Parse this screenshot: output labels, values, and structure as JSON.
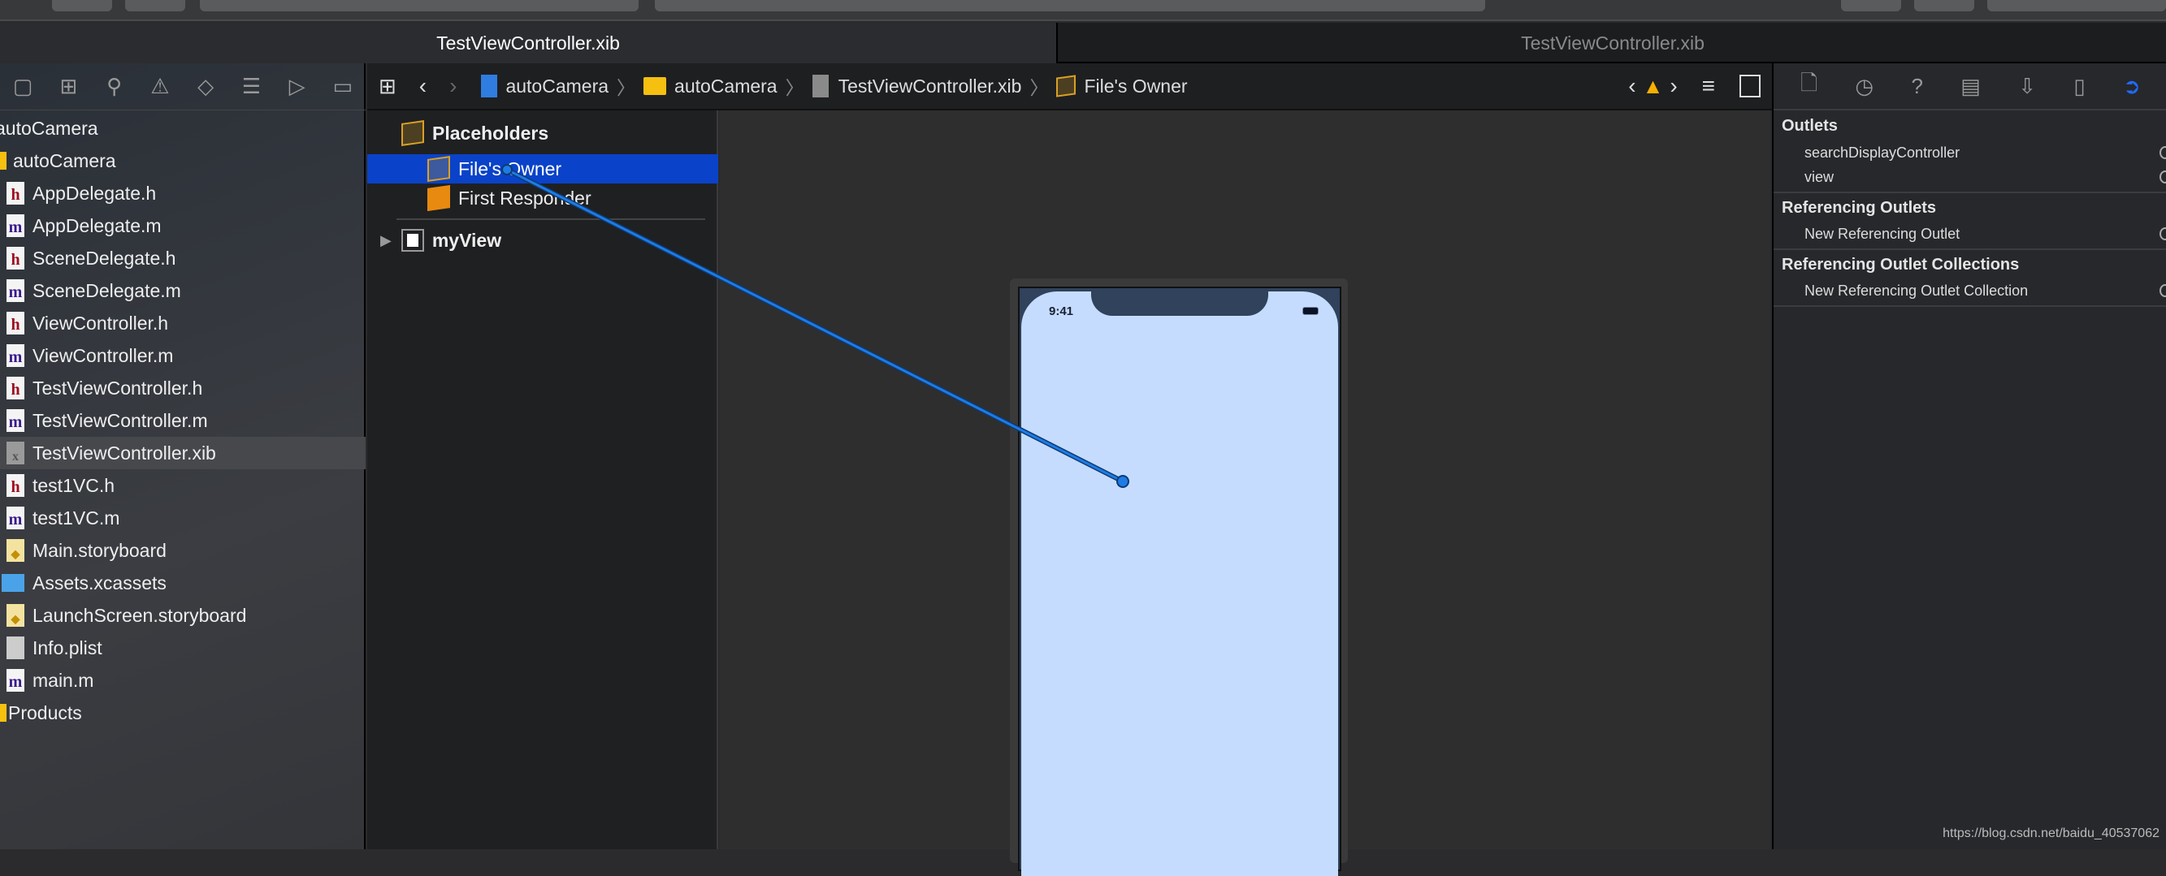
{
  "tabs": [
    {
      "label": "TestViewController.xib",
      "active": true
    },
    {
      "label": "TestViewController.xib",
      "active": false
    }
  ],
  "navigator": {
    "project": "autoCamera",
    "group": "autoCamera",
    "files": [
      {
        "name": "AppDelegate.h",
        "type": "h"
      },
      {
        "name": "AppDelegate.m",
        "type": "m"
      },
      {
        "name": "SceneDelegate.h",
        "type": "h"
      },
      {
        "name": "SceneDelegate.m",
        "type": "m"
      },
      {
        "name": "ViewController.h",
        "type": "h"
      },
      {
        "name": "ViewController.m",
        "type": "m"
      },
      {
        "name": "TestViewController.h",
        "type": "h"
      },
      {
        "name": "TestViewController.m",
        "type": "m"
      },
      {
        "name": "TestViewController.xib",
        "type": "xib",
        "selected": true
      },
      {
        "name": "test1VC.h",
        "type": "h"
      },
      {
        "name": "test1VC.m",
        "type": "m"
      },
      {
        "name": "Main.storyboard",
        "type": "sb"
      },
      {
        "name": "Assets.xcassets",
        "type": "assets"
      },
      {
        "name": "LaunchScreen.storyboard",
        "type": "sb"
      },
      {
        "name": "Info.plist",
        "type": "plist"
      },
      {
        "name": "main.m",
        "type": "m"
      }
    ],
    "products": "Products"
  },
  "jumpbar": {
    "items": [
      "autoCamera",
      "autoCamera",
      "TestViewController.xib",
      "File's Owner"
    ]
  },
  "outline": {
    "placeholders": "Placeholders",
    "files_owner": "File's Owner",
    "first_responder": "First Responder",
    "view": "myView"
  },
  "device": {
    "time": "9:41",
    "screen_color": "#c5dcff"
  },
  "inspector": {
    "outlets_header": "Outlets",
    "outlets": [
      "searchDisplayController",
      "view"
    ],
    "ref_header": "Referencing Outlets",
    "ref_item": "New Referencing Outlet",
    "refcoll_header": "Referencing Outlet Collections",
    "refcoll_item": "New Referencing Outlet Collection"
  },
  "watermark": "https://blog.csdn.net/baidu_40537062",
  "colors": {
    "selection": "#0a43c9",
    "connection": "#1e7be6",
    "accent": "#1f6bff"
  }
}
